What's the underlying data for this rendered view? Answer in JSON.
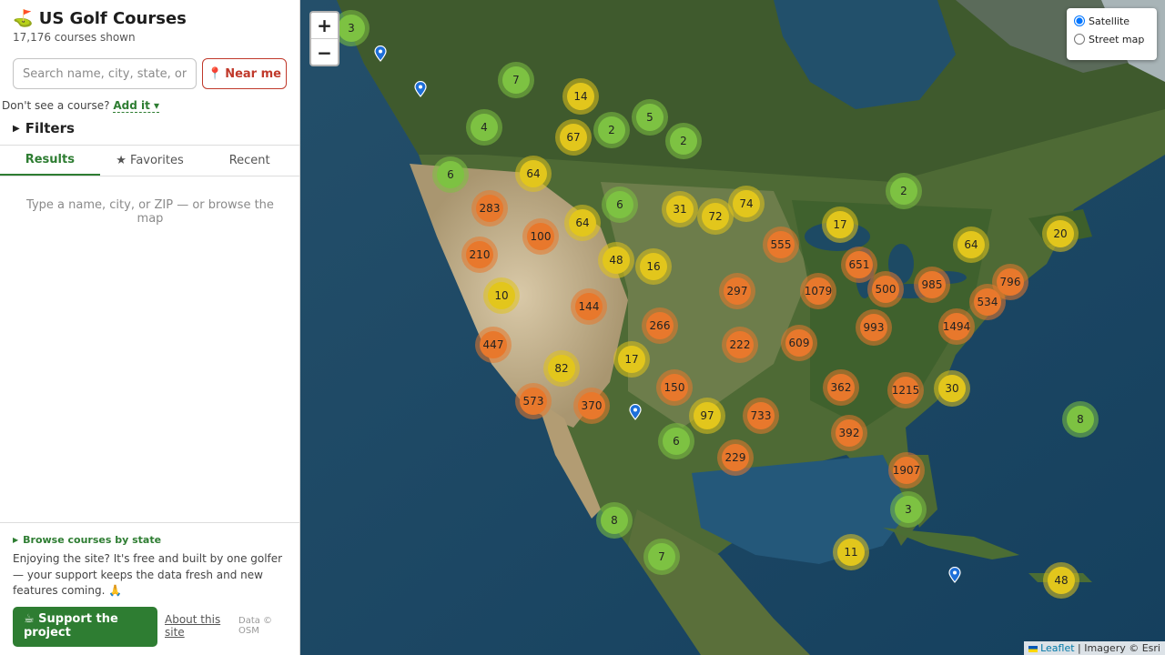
{
  "app": {
    "title": "US Golf Courses",
    "title_icon": "⛳",
    "count_text": "17,176 courses shown"
  },
  "search": {
    "placeholder": "Search name, city, state, or ZIP",
    "near_me_label": "Near me",
    "near_me_icon": "📍"
  },
  "add_course": {
    "prompt": "Don't see a course?",
    "link_label": "Add it ▾"
  },
  "filters": {
    "label": "Filters"
  },
  "tabs": [
    {
      "label": "Results",
      "active": true
    },
    {
      "label": "★ Favorites",
      "active": false
    },
    {
      "label": "Recent",
      "active": false
    }
  ],
  "results": {
    "empty_text": "Type a name, city, or ZIP — or browse the map"
  },
  "footer": {
    "browse_label": "Browse courses by state",
    "support_text": "Enjoying the site? It's free and built by one golfer — your support keeps the data fresh and new features coming. 🙏",
    "support_button": "☕ Support the project",
    "about_link": "About this site",
    "data_credit": "Data © OSM"
  },
  "map": {
    "zoom_in": "+",
    "zoom_out": "−",
    "layers": [
      {
        "label": "Satellite",
        "checked": true
      },
      {
        "label": "Street map",
        "checked": false
      }
    ],
    "attribution_leaflet": "Leaflet",
    "attribution_rest": "| Imagery © Esri",
    "colors": {
      "small": "#7dc242",
      "medium": "#e0c21b",
      "large": "#e8782c",
      "pin": "#1e6fd9"
    },
    "clusters": [
      {
        "count": "3",
        "tier": "small"
      },
      {
        "count": "7",
        "tier": "small"
      },
      {
        "count": "14",
        "tier": "medium"
      },
      {
        "count": "4",
        "tier": "small"
      },
      {
        "count": "5",
        "tier": "small"
      },
      {
        "count": "67",
        "tier": "medium"
      },
      {
        "count": "2",
        "tier": "small"
      },
      {
        "count": "2",
        "tier": "small"
      },
      {
        "count": "6",
        "tier": "small"
      },
      {
        "count": "64",
        "tier": "medium"
      },
      {
        "count": "283",
        "tier": "large"
      },
      {
        "count": "6",
        "tier": "small"
      },
      {
        "count": "31",
        "tier": "medium"
      },
      {
        "count": "74",
        "tier": "medium"
      },
      {
        "count": "72",
        "tier": "medium"
      },
      {
        "count": "2",
        "tier": "small"
      },
      {
        "count": "64",
        "tier": "medium"
      },
      {
        "count": "100",
        "tier": "large"
      },
      {
        "count": "210",
        "tier": "large"
      },
      {
        "count": "17",
        "tier": "medium"
      },
      {
        "count": "555",
        "tier": "large"
      },
      {
        "count": "64",
        "tier": "medium"
      },
      {
        "count": "20",
        "tier": "medium"
      },
      {
        "count": "48",
        "tier": "medium"
      },
      {
        "count": "16",
        "tier": "medium"
      },
      {
        "count": "651",
        "tier": "large"
      },
      {
        "count": "796",
        "tier": "large"
      },
      {
        "count": "10",
        "tier": "medium"
      },
      {
        "count": "297",
        "tier": "large"
      },
      {
        "count": "1079",
        "tier": "large"
      },
      {
        "count": "500",
        "tier": "large"
      },
      {
        "count": "985",
        "tier": "large"
      },
      {
        "count": "534",
        "tier": "large"
      },
      {
        "count": "144",
        "tier": "large"
      },
      {
        "count": "266",
        "tier": "large"
      },
      {
        "count": "993",
        "tier": "large"
      },
      {
        "count": "1494",
        "tier": "large"
      },
      {
        "count": "447",
        "tier": "large"
      },
      {
        "count": "222",
        "tier": "large"
      },
      {
        "count": "609",
        "tier": "large"
      },
      {
        "count": "17",
        "tier": "medium"
      },
      {
        "count": "82",
        "tier": "medium"
      },
      {
        "count": "150",
        "tier": "large"
      },
      {
        "count": "362",
        "tier": "large"
      },
      {
        "count": "1215",
        "tier": "large"
      },
      {
        "count": "30",
        "tier": "medium"
      },
      {
        "count": "573",
        "tier": "large"
      },
      {
        "count": "370",
        "tier": "large"
      },
      {
        "count": "97",
        "tier": "medium"
      },
      {
        "count": "733",
        "tier": "large"
      },
      {
        "count": "8",
        "tier": "small"
      },
      {
        "count": "6",
        "tier": "small"
      },
      {
        "count": "392",
        "tier": "large"
      },
      {
        "count": "229",
        "tier": "large"
      },
      {
        "count": "1907",
        "tier": "large"
      },
      {
        "count": "3",
        "tier": "small"
      },
      {
        "count": "8",
        "tier": "small"
      },
      {
        "count": "7",
        "tier": "small"
      },
      {
        "count": "11",
        "tier": "medium"
      },
      {
        "count": "48",
        "tier": "medium"
      }
    ]
  }
}
